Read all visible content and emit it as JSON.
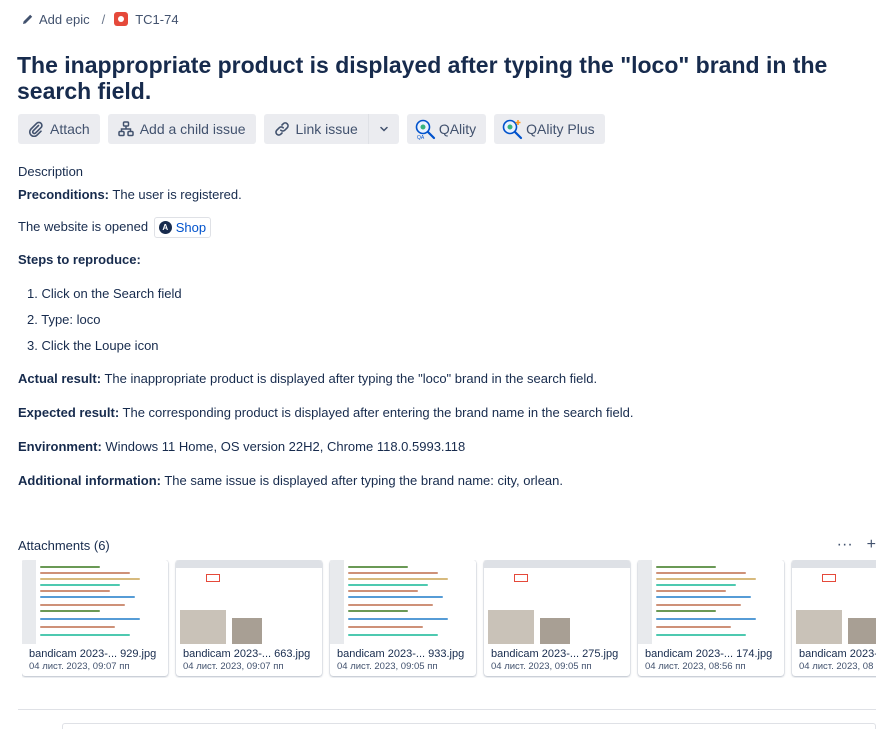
{
  "breadcrumb": {
    "add_epic": "Add epic",
    "separator": "/",
    "issue_key": "TC1-74"
  },
  "title": "The inappropriate product is displayed after typing the \"loco\" brand in the search field.",
  "toolbar": {
    "attach": "Attach",
    "add_child": "Add a child issue",
    "link_issue": "Link issue",
    "qality": "QAlity",
    "qality_plus": "QAlity Plus"
  },
  "description": {
    "label": "Description",
    "preconditions_label": "Preconditions:",
    "preconditions_text": " The user is registered.",
    "website_text": "The website is opened ",
    "shop_label": "Shop",
    "steps_label": "Steps to reproduce:",
    "steps": [
      "1. Click on the Search field",
      "2. Type: loco",
      "3. Click the Loupe icon"
    ],
    "actual_label": "Actual result:",
    "actual_text": " The inappropriate product is displayed after typing the \"loco\" brand in the search field.",
    "expected_label": "Expected result:",
    "expected_text": " The corresponding product is displayed after entering the brand name in the search field.",
    "environment_label": "Environment:",
    "environment_text": " Windows 11 Home, OS version 22H2, Chrome 118.0.5993.118",
    "additional_label": "Additional information:",
    "additional_text": " The same issue is displayed after typing the brand name: city, orlean."
  },
  "attachments": {
    "header": "Attachments (6)",
    "more_icon": "···",
    "add_icon": "+",
    "items": [
      {
        "name": "bandicam 2023-... 929.jpg",
        "date": "04 лист. 2023, 09:07 пп",
        "kind": "code"
      },
      {
        "name": "bandicam 2023-... 663.jpg",
        "date": "04 лист. 2023, 09:07 пп",
        "kind": "site"
      },
      {
        "name": "bandicam 2023-... 933.jpg",
        "date": "04 лист. 2023, 09:05 пп",
        "kind": "code"
      },
      {
        "name": "bandicam 2023-... 275.jpg",
        "date": "04 лист. 2023, 09:05 пп",
        "kind": "site"
      },
      {
        "name": "bandicam 2023-... 174.jpg",
        "date": "04 лист. 2023, 08:56 пп",
        "kind": "code"
      },
      {
        "name": "bandicam 2023-...",
        "date": "04 лист. 2023, 08",
        "kind": "site"
      }
    ]
  },
  "colors": {
    "bug": "#e5493a",
    "link": "#0052cc",
    "button_bg": "#ebecf0"
  }
}
